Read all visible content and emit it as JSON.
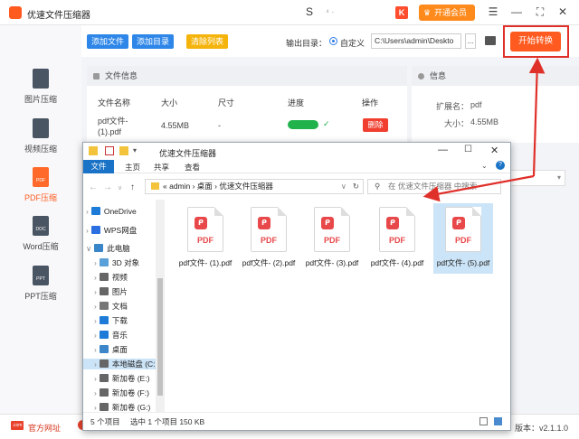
{
  "app": {
    "title": "优速文件压缩器",
    "vip_label": "开通会员",
    "k_label": "K",
    "deco_s": "S",
    "deco_misc": "⁴ ·",
    "win_menu": "☰",
    "win_min": "—",
    "win_max": "⛶",
    "win_close": "✕"
  },
  "sidebar": {
    "items": [
      {
        "label": "图片压缩",
        "icon": ""
      },
      {
        "label": "视频压缩",
        "icon": ""
      },
      {
        "label": "PDF压缩",
        "icon": "PDF"
      },
      {
        "label": "Word压缩",
        "icon": "DOC"
      },
      {
        "label": "PPT压缩",
        "icon": "PPT"
      }
    ]
  },
  "toolbar": {
    "add_file": "添加文件",
    "add_dir": "添加目录",
    "clear_list": "清除列表",
    "output_label": "输出目录：",
    "custom_label": "自定义",
    "output_path": "C:\\Users\\admin\\Deskto",
    "browse": "...",
    "start": "开始转换"
  },
  "file_info": {
    "title": "文件信息",
    "columns": [
      "文件名称",
      "大小",
      "尺寸",
      "进度",
      "操作"
    ],
    "row": {
      "name": "pdf文件-(1).pdf",
      "size": "4.55MB",
      "dim": "-",
      "delete": "删除",
      "check": "✓"
    }
  },
  "info": {
    "title": "信息",
    "ext_label": "扩展名：",
    "ext_value": "pdf",
    "size_label": "大小：",
    "size_value": "4.55MB"
  },
  "explorer": {
    "title": "优速文件压缩器",
    "ribbon": [
      "文件",
      "主页",
      "共享",
      "查看"
    ],
    "address": "«  admin  ›  桌面  ›  优速文件压缩器",
    "search_placeholder": "在 优速文件压缩器 中搜索",
    "tree": [
      {
        "label": "OneDrive",
        "color": "#1e7bd8"
      },
      {
        "label": "WPS网盘",
        "color": "#2b6fe0"
      },
      {
        "label": "此电脑",
        "color": "#3a86c8"
      },
      {
        "label": "3D 对象",
        "color": "#5aa0d8"
      },
      {
        "label": "视频",
        "color": "#666"
      },
      {
        "label": "图片",
        "color": "#666"
      },
      {
        "label": "文档",
        "color": "#777"
      },
      {
        "label": "下载",
        "color": "#1e7bd8"
      },
      {
        "label": "音乐",
        "color": "#1e7bd8"
      },
      {
        "label": "桌面",
        "color": "#3a86c8"
      },
      {
        "label": "本地磁盘 (C:)",
        "color": "#666"
      },
      {
        "label": "新加卷 (E:)",
        "color": "#666"
      },
      {
        "label": "新加卷 (F:)",
        "color": "#666"
      },
      {
        "label": "新加卷 (G:)",
        "color": "#666"
      }
    ],
    "files": [
      "pdf文件- (1).pdf",
      "pdf文件- (2).pdf",
      "pdf文件- (3).pdf",
      "pdf文件- (4).pdf",
      "pdf文件- (5).pdf"
    ],
    "file_icon_text": "PDF",
    "status_count": "5 个项目",
    "status_sel": "选中 1 个项目  150 KB"
  },
  "statusbar": {
    "site_label": "官方网址",
    "version": "版本：v2.1.1.0"
  },
  "colors": {
    "accent": "#ff5a1f",
    "blue": "#2d86e8",
    "yellow": "#f5b40c",
    "red": "#e0302a",
    "green": "#22b24c"
  }
}
